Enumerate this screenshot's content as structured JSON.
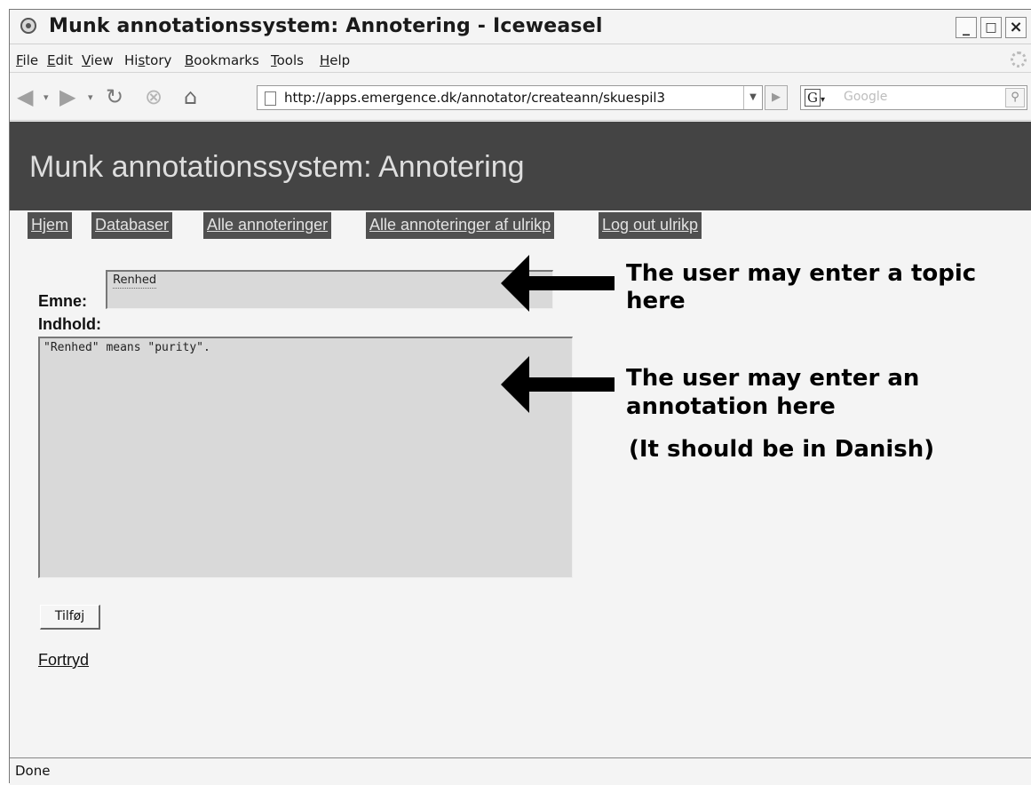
{
  "window": {
    "title": "Munk annotationssystem: Annotering - Iceweasel",
    "controls": {
      "minimize": "_",
      "maximize": "□",
      "close": "×"
    }
  },
  "menubar": {
    "items": [
      {
        "label": "File",
        "mnemonic": "F",
        "rest": "ile"
      },
      {
        "label": "Edit",
        "mnemonic": "E",
        "rest": "dit"
      },
      {
        "label": "View",
        "mnemonic": "V",
        "rest": "iew"
      },
      {
        "label": "History",
        "pre": "Hi",
        "mnemonic": "s",
        "rest": "tory"
      },
      {
        "label": "Bookmarks",
        "mnemonic": "B",
        "rest": "ookmarks"
      },
      {
        "label": "Tools",
        "mnemonic": "T",
        "rest": "ools"
      },
      {
        "label": "Help",
        "mnemonic": "H",
        "rest": "elp"
      }
    ]
  },
  "navbar": {
    "url": "http://apps.emergence.dk/annotator/createann/skuespil3",
    "search_placeholder": "Google",
    "search_engine": "G"
  },
  "page": {
    "site_title": "Munk annotationssystem: Annotering",
    "tabs": [
      "Hjem",
      "Databaser",
      "Alle annoteringer",
      "Alle annoteringer af ulrikp",
      "Log out ulrikp"
    ],
    "emne_label": "Emne:",
    "emne_value": "Renhed",
    "indhold_label": "Indhold:",
    "indhold_value": "\"Renhed\" means \"purity\".",
    "submit_label": "Tilføj",
    "cancel_link": "Fortryd"
  },
  "annotations": {
    "topic_note_line1": "The user may enter a topic",
    "topic_note_line2": "here",
    "content_note_line1": "The user may enter an",
    "content_note_line2": "annotation here",
    "content_note_line3": "(It should be in Danish)"
  },
  "status": {
    "text": "Done"
  },
  "colors": {
    "header_band": "#444444",
    "tab_bg": "#505050",
    "field_bg": "#d9d9d9",
    "page_bg": "#f4f4f4"
  }
}
